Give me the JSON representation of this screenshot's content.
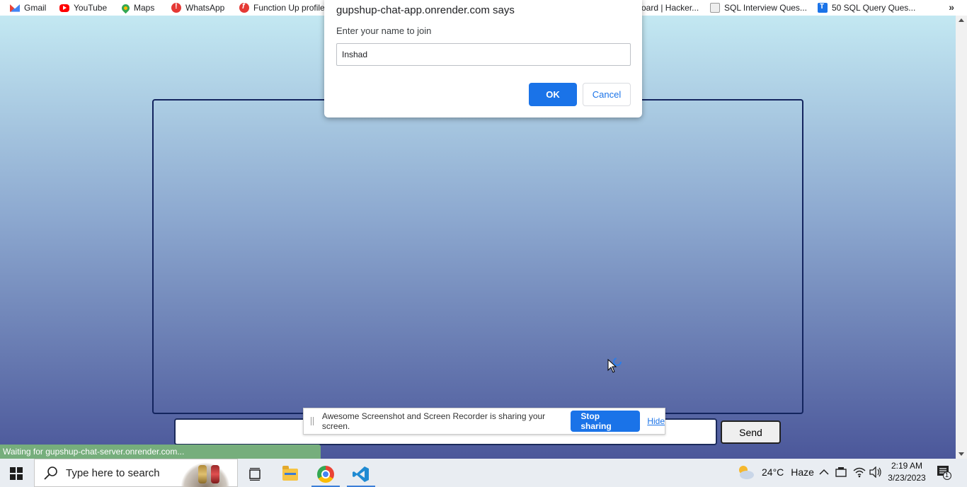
{
  "bookmarks": [
    {
      "label": "Gmail",
      "icon": "gmail-icon"
    },
    {
      "label": "YouTube",
      "icon": "youtube-icon"
    },
    {
      "label": "Maps",
      "icon": "maps-icon"
    },
    {
      "label": "WhatsApp",
      "icon": "whatsapp-icon"
    },
    {
      "label": "Function Up profile",
      "icon": "functionup-icon"
    },
    {
      "label": "oard | Hacker...",
      "icon": ""
    },
    {
      "label": "SQL Interview Ques...",
      "icon": "sql-icon"
    },
    {
      "label": "50 SQL Query Ques...",
      "icon": "t-icon"
    }
  ],
  "dialog": {
    "title": "gupshup-chat-app.onrender.com says",
    "message": "Enter your name to join",
    "input_value": "Inshad",
    "ok_label": "OK",
    "cancel_label": "Cancel"
  },
  "chat": {
    "message_value": "",
    "send_label": "Send"
  },
  "status_text": "Waiting for gupshup-chat-server.onrender.com...",
  "share_bar": {
    "text": "Awesome Screenshot and Screen Recorder is sharing your screen.",
    "stop_label": "Stop sharing",
    "hide_label": "Hide"
  },
  "taskbar": {
    "search_placeholder": "Type here to search",
    "weather_temp": "24°C",
    "weather_desc": "Haze",
    "time": "2:19 AM",
    "date": "3/23/2023",
    "notification_count": "1"
  },
  "colors": {
    "accent": "#1a73e8",
    "status_bar": "#76ae7c",
    "chat_border": "#13245e",
    "gradient_top": "#c3e8f2",
    "gradient_bottom": "#4b579a"
  }
}
